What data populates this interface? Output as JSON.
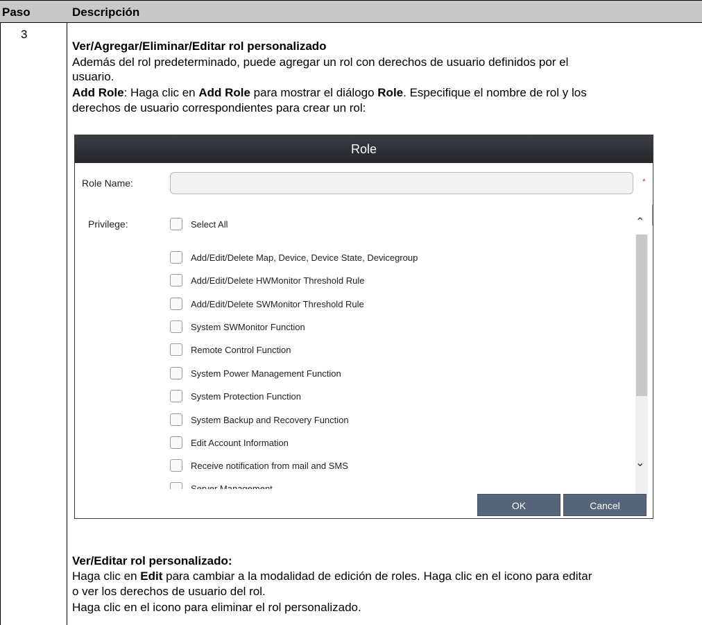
{
  "table": {
    "header": {
      "paso": "Paso",
      "descripcion": "Descripción"
    },
    "step": "3"
  },
  "content": {
    "title": "Ver/Agregar/Eliminar/Editar rol personalizado",
    "intro_line1": "Además del rol predeterminado, puede agregar un rol con derechos de usuario definidos por el",
    "intro_line2": "usuario.",
    "add_role_label": "Add Role",
    "add_role_text1": ": Haga clic en ",
    "add_role_button_ref": "Add Role",
    "add_role_text2": " para mostrar el diálogo ",
    "role_ref": "Role",
    "add_role_text3": ". Especifique el nombre de rol y los",
    "add_role_line2": "derechos de usuario correspondientes para crear un rol:",
    "view_edit_title": "Ver/Editar rol personalizado:",
    "edit_text1": "Haga clic en ",
    "edit_ref": "Edit",
    "edit_text2": " para cambiar a la modalidad de edición de roles. Haga clic en el icono para editar",
    "edit_line2": "o ver los derechos de usuario del rol.",
    "delete_line": "Haga clic en el icono para eliminar el rol personalizado."
  },
  "dialog": {
    "title": "Role",
    "role_name_label": "Role Name:",
    "role_name_value": "",
    "required_mark": "*",
    "privilege_label": "Privilege:",
    "select_all": "Select All",
    "privileges": [
      "Add/Edit/Delete Map, Device, Device State, Devicegroup",
      "Add/Edit/Delete HWMonitor Threshold Rule",
      "Add/Edit/Delete SWMonitor Threshold Rule",
      "System SWMonitor Function",
      "Remote Control Function",
      "System Power Management Function",
      "System Protection Function",
      "System Backup and Recovery Function",
      "Edit Account Information",
      "Receive notification from mail and SMS",
      "Server Management"
    ],
    "ok_label": "OK",
    "cancel_label": "Cancel",
    "scroll_up_icon": "chevron-up-icon",
    "scroll_down_icon": "chevron-down-icon"
  }
}
